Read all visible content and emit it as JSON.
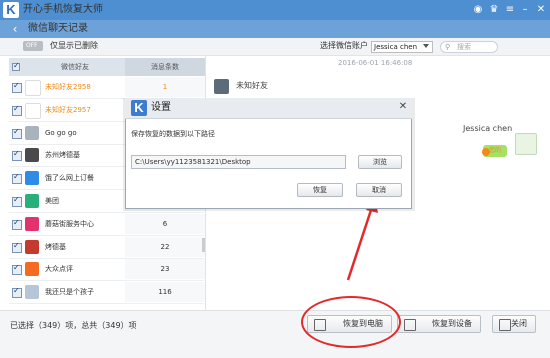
{
  "window": {
    "title": "开心手机恢复大师",
    "logo_letter": "K",
    "icons": [
      "chat-bubble-icon",
      "shirt-icon",
      "menu-icon",
      "minimize-icon",
      "close-icon"
    ]
  },
  "subheader": {
    "title": "微信聊天记录",
    "back_icon": "back-arrow-icon"
  },
  "toolbar": {
    "toggle_state": "OFF",
    "only_deleted_label": "仅显示已删除",
    "account_label": "选择微信账户",
    "account_value": "Jessica chen",
    "search_placeholder": "搜索"
  },
  "list": {
    "col_name": "微信好友",
    "col_count": "消息条数",
    "rows": [
      {
        "name": "未知好友2958",
        "count": "1",
        "highlight": true,
        "avatar_color": "#ffffff"
      },
      {
        "name": "未知好友2957",
        "count": "1",
        "highlight": true,
        "avatar_color": "#ffffff"
      },
      {
        "name": "Go go go",
        "count": "",
        "highlight": false,
        "avatar_color": "#a9b3bd"
      },
      {
        "name": "苏州烤德基",
        "count": "",
        "highlight": false,
        "avatar_color": "#4a4a4a"
      },
      {
        "name": "饿了么网上订餐",
        "count": "",
        "highlight": false,
        "avatar_color": "#2e8be6"
      },
      {
        "name": "美团",
        "count": "",
        "highlight": false,
        "avatar_color": "#27b07a"
      },
      {
        "name": "蘑菇街服务中心",
        "count": "6",
        "highlight": false,
        "avatar_color": "#e2336e"
      },
      {
        "name": "烤德基",
        "count": "22",
        "highlight": false,
        "avatar_color": "#c43a2e"
      },
      {
        "name": "大众点评",
        "count": "23",
        "highlight": false,
        "avatar_color": "#f26b21"
      },
      {
        "name": "我还只是个孩子",
        "count": "116",
        "highlight": false,
        "avatar_color": "#b6c6d8"
      }
    ]
  },
  "chat": {
    "timestamp": "2016-06-01 16:46:08",
    "left_name": "未知好友",
    "right_name": "Jessica chen",
    "bubble_text": "您的"
  },
  "status": {
    "selection": "已选择（349）项，总共（349）项"
  },
  "buttons": {
    "restore_pc": "恢复到电脑",
    "restore_device": "恢复到设备",
    "close": "关闭"
  },
  "dialog": {
    "title": "设置",
    "description": "保存恢复的数据到以下路径",
    "path": "C:\\Users\\yy1123581321\\Desktop",
    "browse": "浏览",
    "restore": "恢复",
    "cancel": "取消"
  },
  "colors": {
    "titlebar": "#4d8fd0",
    "highlight_text": "#f08a18",
    "annotation_red": "#e32a2a"
  }
}
